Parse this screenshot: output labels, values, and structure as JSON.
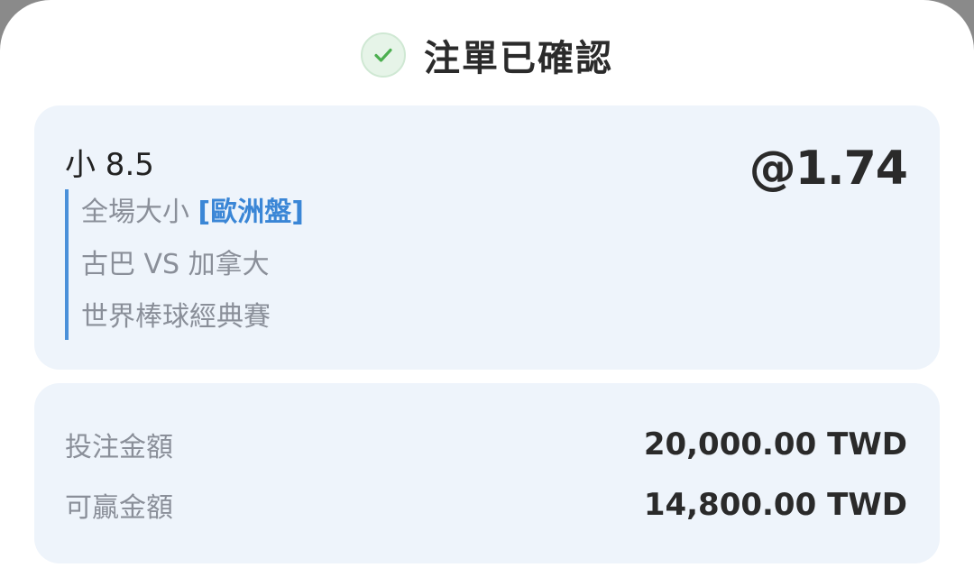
{
  "header": {
    "title": "注單已確認",
    "icon": "check-circle-icon",
    "icon_color": "#4caf50"
  },
  "bet": {
    "selection": "小 8.5",
    "odds": "@1.74",
    "market": "全場大小",
    "market_tag": "[歐洲盤]",
    "match": "古巴 VS 加拿大",
    "league": "世界棒球經典賽",
    "accent_color": "#4a90d9"
  },
  "amounts": {
    "stake_label": "投注金額",
    "stake_value": "20,000.00 TWD",
    "win_label": "可贏金額",
    "win_value": "14,800.00 TWD"
  }
}
